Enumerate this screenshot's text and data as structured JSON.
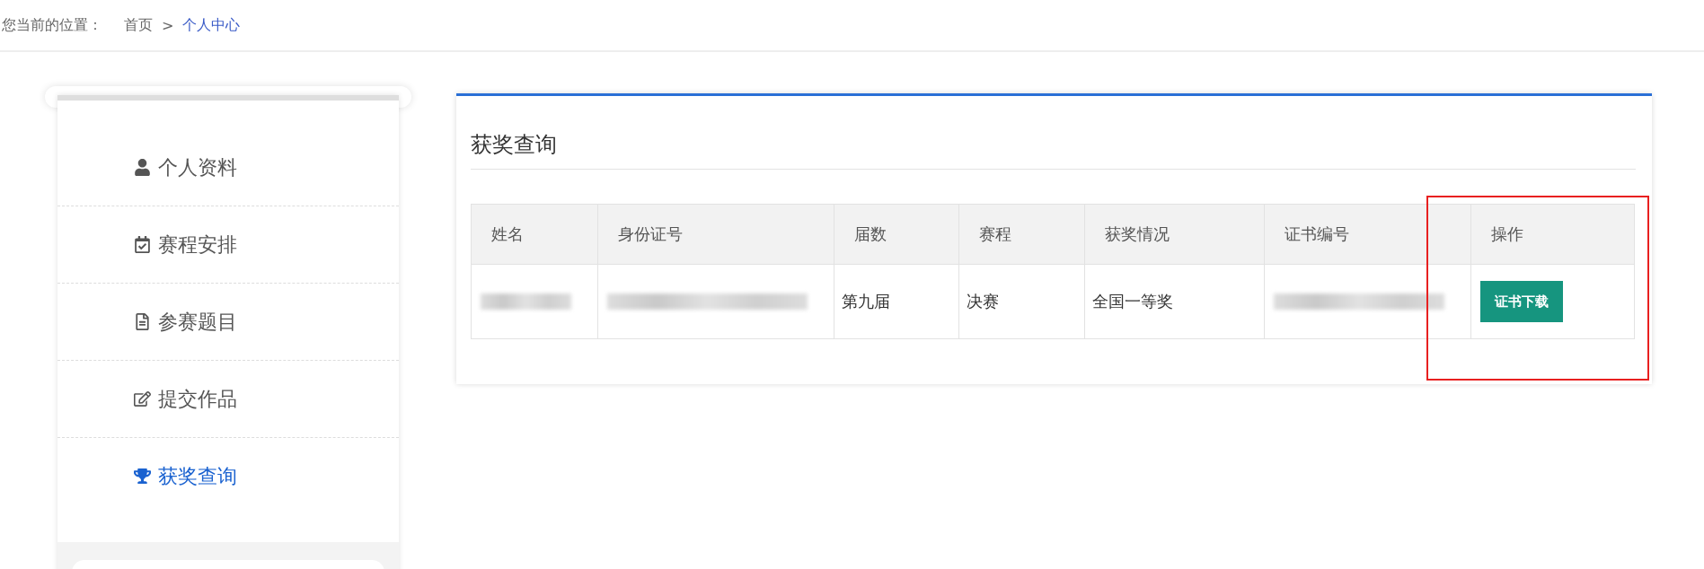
{
  "breadcrumb": {
    "label": "您当前的位置：",
    "items": [
      {
        "text": "首页",
        "selected": false
      },
      {
        "text": "个人中心",
        "selected": true
      }
    ],
    "separator": ">"
  },
  "sidebar": {
    "items": [
      {
        "label": "个人资料",
        "selected": false
      },
      {
        "label": "赛程安排",
        "selected": false
      },
      {
        "label": "参赛题目",
        "selected": false
      },
      {
        "label": "提交作品",
        "selected": false
      },
      {
        "label": "获奖查询",
        "selected": true
      }
    ]
  },
  "panel": {
    "title": "获奖查询",
    "table": {
      "columns": [
        {
          "label": "姓名",
          "highlighted": false
        },
        {
          "label": "身份证号",
          "highlighted": false
        },
        {
          "label": "届数",
          "highlighted": false
        },
        {
          "label": "赛程",
          "highlighted": false
        },
        {
          "label": "获奖情况",
          "highlighted": false
        },
        {
          "label": "证书编号",
          "highlighted": false
        },
        {
          "label": "操作",
          "highlighted": true
        }
      ],
      "rows": [
        {
          "cells": [
            {
              "kind": "blurred"
            },
            {
              "kind": "blurred"
            },
            {
              "kind": "text",
              "text": "第九届"
            },
            {
              "kind": "text",
              "text": "决赛"
            },
            {
              "kind": "text",
              "text": "全国一等奖"
            },
            {
              "kind": "blurred"
            },
            {
              "kind": "button",
              "text": "证书下载"
            }
          ]
        }
      ]
    }
  }
}
